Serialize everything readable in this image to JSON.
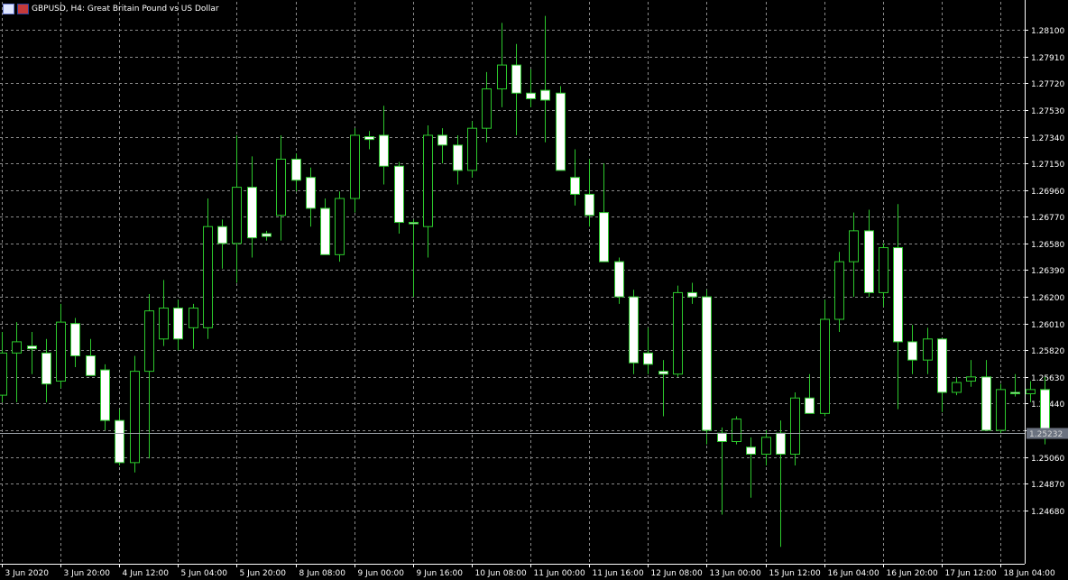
{
  "title": "GBPUSD, H4:  Great Britain Pound vs US Dollar",
  "icons": [
    "window-menu-icon",
    "flag-icon"
  ],
  "colors": {
    "background": "#000000",
    "grid": "#8a8a8a",
    "bull_fill": "#000000",
    "bear_fill": "#ffffff",
    "candle_stroke": "#2cc82c",
    "axis": "#ffffff",
    "price_line": "#9aa0a6",
    "price_label_bg": "#6b7280"
  },
  "chart_data": {
    "type": "candlestick",
    "symbol": "GBPUSD",
    "timeframe": "H4",
    "ylim": [
      1.243,
      1.283
    ],
    "y_ticks": [
      "1.28100",
      "1.27910",
      "1.27720",
      "1.27530",
      "1.27340",
      "1.27150",
      "1.26960",
      "1.26770",
      "1.26580",
      "1.26390",
      "1.26200",
      "1.26010",
      "1.25820",
      "1.25630",
      "1.25440",
      "1.25250",
      "1.25060",
      "1.24870",
      "1.24680"
    ],
    "x_labels": [
      "3 Jun 2020",
      "3 Jun 20:00",
      "4 Jun 12:00",
      "5 Jun 04:00",
      "5 Jun 20:00",
      "8 Jun 08:00",
      "9 Jun 00:00",
      "9 Jun 16:00",
      "10 Jun 08:00",
      "11 Jun 00:00",
      "11 Jun 16:00",
      "12 Jun 08:00",
      "13 Jun 00:00",
      "15 Jun 12:00",
      "16 Jun 04:00",
      "16 Jun 20:00",
      "17 Jun 12:00",
      "18 Jun 04:00"
    ],
    "x_label_every": 4,
    "current_price": "1.25232",
    "candles": [
      {
        "o": 1.255,
        "h": 1.2595,
        "l": 1.2545,
        "c": 1.258
      },
      {
        "o": 1.258,
        "h": 1.2602,
        "l": 1.2545,
        "c": 1.2588
      },
      {
        "o": 1.2585,
        "h": 1.2595,
        "l": 1.2565,
        "c": 1.2583
      },
      {
        "o": 1.258,
        "h": 1.259,
        "l": 1.2545,
        "c": 1.2558
      },
      {
        "o": 1.256,
        "h": 1.2615,
        "l": 1.2555,
        "c": 1.2602
      },
      {
        "o": 1.2601,
        "h": 1.2605,
        "l": 1.257,
        "c": 1.2578
      },
      {
        "o": 1.2578,
        "h": 1.259,
        "l": 1.2568,
        "c": 1.2564
      },
      {
        "o": 1.2568,
        "h": 1.2572,
        "l": 1.2525,
        "c": 1.2532
      },
      {
        "o": 1.2532,
        "h": 1.254,
        "l": 1.25,
        "c": 1.2502
      },
      {
        "o": 1.2502,
        "h": 1.2578,
        "l": 1.2495,
        "c": 1.2567
      },
      {
        "o": 1.2567,
        "h": 1.2622,
        "l": 1.2505,
        "c": 1.261
      },
      {
        "o": 1.259,
        "h": 1.2632,
        "l": 1.2585,
        "c": 1.2612
      },
      {
        "o": 1.2612,
        "h": 1.2618,
        "l": 1.2582,
        "c": 1.259
      },
      {
        "o": 1.2598,
        "h": 1.2615,
        "l": 1.2583,
        "c": 1.2612
      },
      {
        "o": 1.2598,
        "h": 1.269,
        "l": 1.259,
        "c": 1.267
      },
      {
        "o": 1.267,
        "h": 1.2675,
        "l": 1.264,
        "c": 1.2658
      },
      {
        "o": 1.2658,
        "h": 1.2735,
        "l": 1.263,
        "c": 1.2698
      },
      {
        "o": 1.2698,
        "h": 1.272,
        "l": 1.2648,
        "c": 1.2662
      },
      {
        "o": 1.2665,
        "h": 1.2667,
        "l": 1.266,
        "c": 1.2663
      },
      {
        "o": 1.2678,
        "h": 1.2735,
        "l": 1.266,
        "c": 1.2718
      },
      {
        "o": 1.2718,
        "h": 1.2722,
        "l": 1.2695,
        "c": 1.2703
      },
      {
        "o": 1.2705,
        "h": 1.2712,
        "l": 1.267,
        "c": 1.2683
      },
      {
        "o": 1.2683,
        "h": 1.269,
        "l": 1.2655,
        "c": 1.265
      },
      {
        "o": 1.265,
        "h": 1.2695,
        "l": 1.2645,
        "c": 1.269
      },
      {
        "o": 1.269,
        "h": 1.274,
        "l": 1.268,
        "c": 1.2735
      },
      {
        "o": 1.2734,
        "h": 1.2738,
        "l": 1.2725,
        "c": 1.2732
      },
      {
        "o": 1.2735,
        "h": 1.2756,
        "l": 1.27,
        "c": 1.2713
      },
      {
        "o": 1.2713,
        "h": 1.2716,
        "l": 1.2665,
        "c": 1.2673
      },
      {
        "o": 1.2673,
        "h": 1.2675,
        "l": 1.262,
        "c": 1.2672
      },
      {
        "o": 1.267,
        "h": 1.2742,
        "l": 1.2648,
        "c": 1.2735
      },
      {
        "o": 1.2735,
        "h": 1.274,
        "l": 1.2715,
        "c": 1.2728
      },
      {
        "o": 1.2728,
        "h": 1.2735,
        "l": 1.27,
        "c": 1.271
      },
      {
        "o": 1.271,
        "h": 1.2745,
        "l": 1.2705,
        "c": 1.274
      },
      {
        "o": 1.274,
        "h": 1.278,
        "l": 1.273,
        "c": 1.2768
      },
      {
        "o": 1.2768,
        "h": 1.2815,
        "l": 1.2755,
        "c": 1.2785
      },
      {
        "o": 1.2785,
        "h": 1.28,
        "l": 1.2735,
        "c": 1.2765
      },
      {
        "o": 1.2765,
        "h": 1.2782,
        "l": 1.2755,
        "c": 1.2761
      },
      {
        "o": 1.2767,
        "h": 1.282,
        "l": 1.273,
        "c": 1.276
      },
      {
        "o": 1.2765,
        "h": 1.277,
        "l": 1.271,
        "c": 1.271
      },
      {
        "o": 1.2705,
        "h": 1.2725,
        "l": 1.2685,
        "c": 1.2693
      },
      {
        "o": 1.2693,
        "h": 1.2718,
        "l": 1.267,
        "c": 1.2678
      },
      {
        "o": 1.268,
        "h": 1.2715,
        "l": 1.265,
        "c": 1.2645
      },
      {
        "o": 1.2645,
        "h": 1.2648,
        "l": 1.2615,
        "c": 1.262
      },
      {
        "o": 1.262,
        "h": 1.2625,
        "l": 1.2565,
        "c": 1.2573
      },
      {
        "o": 1.258,
        "h": 1.2598,
        "l": 1.2565,
        "c": 1.2572
      },
      {
        "o": 1.2567,
        "h": 1.2575,
        "l": 1.2535,
        "c": 1.2565
      },
      {
        "o": 1.2565,
        "h": 1.2628,
        "l": 1.2563,
        "c": 1.2623
      },
      {
        "o": 1.2623,
        "h": 1.263,
        "l": 1.2615,
        "c": 1.262
      },
      {
        "o": 1.262,
        "h": 1.2625,
        "l": 1.2515,
        "c": 1.2525
      },
      {
        "o": 1.2523,
        "h": 1.2527,
        "l": 1.2465,
        "c": 1.2517
      },
      {
        "o": 1.2517,
        "h": 1.2535,
        "l": 1.2515,
        "c": 1.2533
      },
      {
        "o": 1.2513,
        "h": 1.252,
        "l": 1.2477,
        "c": 1.2508
      },
      {
        "o": 1.2508,
        "h": 1.2525,
        "l": 1.25,
        "c": 1.252
      },
      {
        "o": 1.2523,
        "h": 1.2532,
        "l": 1.2442,
        "c": 1.2508
      },
      {
        "o": 1.2508,
        "h": 1.2552,
        "l": 1.25,
        "c": 1.2548
      },
      {
        "o": 1.2548,
        "h": 1.2565,
        "l": 1.2537,
        "c": 1.2537
      },
      {
        "o": 1.2537,
        "h": 1.2618,
        "l": 1.2535,
        "c": 1.2604
      },
      {
        "o": 1.2604,
        "h": 1.2652,
        "l": 1.2595,
        "c": 1.2645
      },
      {
        "o": 1.2645,
        "h": 1.268,
        "l": 1.262,
        "c": 1.2667
      },
      {
        "o": 1.2667,
        "h": 1.2682,
        "l": 1.262,
        "c": 1.2623
      },
      {
        "o": 1.2623,
        "h": 1.2658,
        "l": 1.2613,
        "c": 1.2655
      },
      {
        "o": 1.2655,
        "h": 1.2686,
        "l": 1.254,
        "c": 1.2588
      },
      {
        "o": 1.2588,
        "h": 1.26,
        "l": 1.2565,
        "c": 1.2575
      },
      {
        "o": 1.2575,
        "h": 1.2598,
        "l": 1.2565,
        "c": 1.259
      },
      {
        "o": 1.259,
        "h": 1.259,
        "l": 1.2538,
        "c": 1.2552
      },
      {
        "o": 1.2552,
        "h": 1.2563,
        "l": 1.255,
        "c": 1.2559
      },
      {
        "o": 1.256,
        "h": 1.2575,
        "l": 1.2556,
        "c": 1.2563
      },
      {
        "o": 1.2563,
        "h": 1.2575,
        "l": 1.2525,
        "c": 1.2525
      },
      {
        "o": 1.2525,
        "h": 1.2558,
        "l": 1.2523,
        "c": 1.2554
      },
      {
        "o": 1.2552,
        "h": 1.2565,
        "l": 1.2549,
        "c": 1.2551
      },
      {
        "o": 1.2551,
        "h": 1.256,
        "l": 1.2545,
        "c": 1.2554
      },
      {
        "o": 1.2554,
        "h": 1.2563,
        "l": 1.2515,
        "c": 1.2523
      }
    ]
  }
}
